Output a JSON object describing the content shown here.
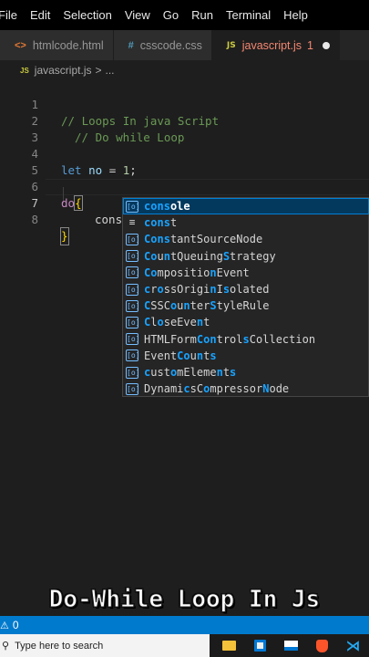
{
  "menubar": {
    "items": [
      "File",
      "Edit",
      "Selection",
      "View",
      "Go",
      "Run",
      "Terminal",
      "Help"
    ]
  },
  "tabs": [
    {
      "icon": "<>",
      "label": "htmlcode.html"
    },
    {
      "icon": "#",
      "label": "csscode.css"
    },
    {
      "icon": "JS",
      "label": "javascript.js",
      "badge": "1"
    }
  ],
  "breadcrumb": {
    "icon": "JS",
    "file": "javascript.js",
    "separator": ">",
    "more": "..."
  },
  "editor": {
    "line_numbers": [
      "1",
      "2",
      "3",
      "4",
      "5",
      "6",
      "7",
      "8"
    ],
    "line1": "// Loops In java Script",
    "line2": "// Do while Loop",
    "line4": {
      "kw": "let",
      "var": "no",
      "op": " = ",
      "num": "1",
      "end": ";"
    },
    "line6": {
      "kw": "do",
      "brace": "{"
    },
    "line7": "cons",
    "line8": "}"
  },
  "suggest": {
    "items": [
      {
        "icon": "[o]",
        "label": "console"
      },
      {
        "icon": "≡",
        "label": "const"
      },
      {
        "icon": "[o]",
        "label": "ConstantSourceNode"
      },
      {
        "icon": "[o]",
        "label": "CountQueuingStrategy"
      },
      {
        "icon": "[o]",
        "label": "CompositionEvent"
      },
      {
        "icon": "[o]",
        "label": "crossOriginIsolated"
      },
      {
        "icon": "[o]",
        "label": "CSSCounterStyleRule"
      },
      {
        "icon": "[o]",
        "label": "CloseEvent"
      },
      {
        "icon": "[o]",
        "label": "HTMLFormControlsCollection"
      },
      {
        "icon": "[o]",
        "label": "EventCounts"
      },
      {
        "icon": "[o]",
        "label": "customElements"
      },
      {
        "icon": "[o]",
        "label": "DynamicsCompressorNode"
      }
    ]
  },
  "overlay": {
    "title": "Do-While Loop In Js"
  },
  "statusbar": {
    "problems": "0"
  },
  "taskbar": {
    "search_placeholder": "Type here to search"
  },
  "colors": {
    "accent": "#007acc",
    "tab_active_text": "#f48771",
    "selection": "#04395e"
  }
}
